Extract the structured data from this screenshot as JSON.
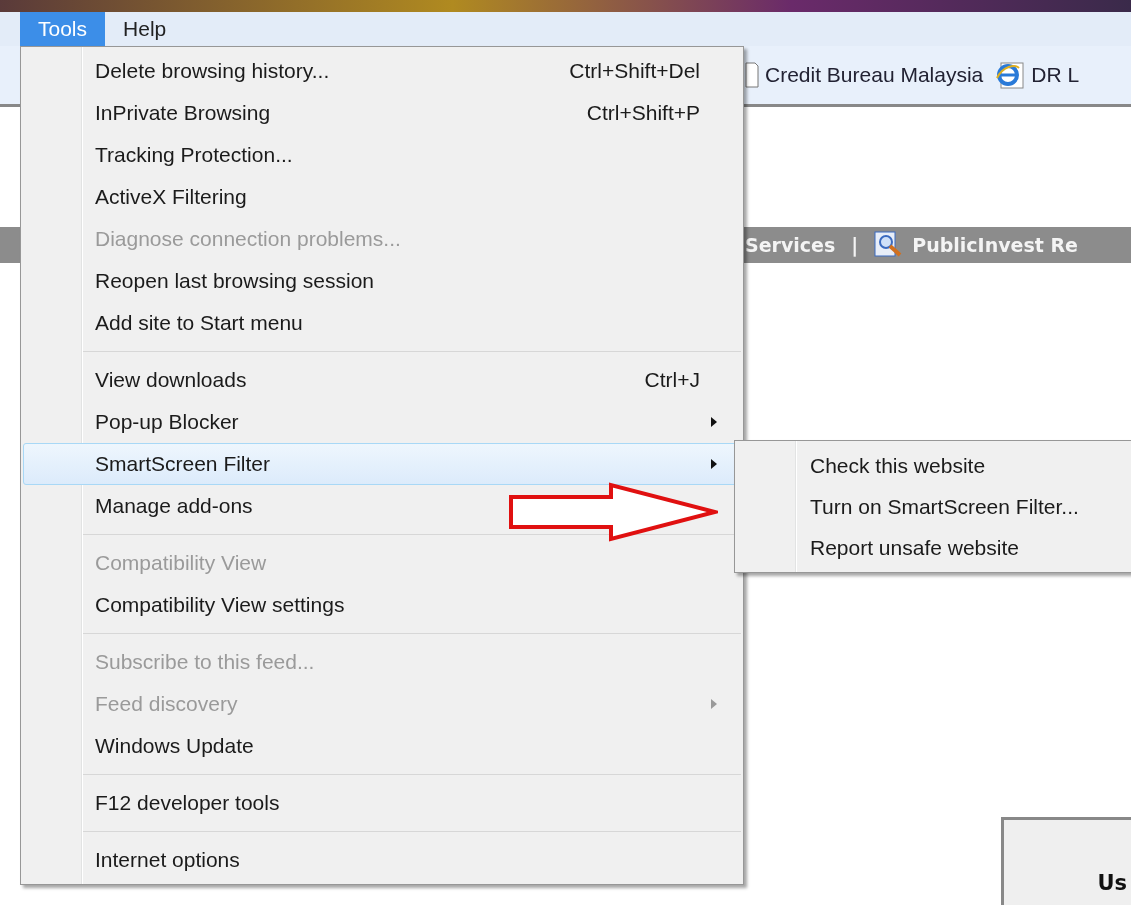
{
  "menu_bar": [
    {
      "label": "Tools",
      "selected": true
    },
    {
      "label": "Help",
      "selected": false
    }
  ],
  "favorites_bar": [
    {
      "label": "Credit Bureau Malaysia"
    },
    {
      "label": "DR L"
    }
  ],
  "nav_strip": [
    {
      "label": "Services"
    },
    {
      "label": "PublicInvest Re"
    }
  ],
  "nav_divider": "|",
  "content_box": {
    "label": "Us"
  },
  "tools_menu": [
    {
      "kind": "item",
      "label": "Delete browsing history...",
      "shortcut": "Ctrl+Shift+Del",
      "disabled": false,
      "submenu": false,
      "selected": false
    },
    {
      "kind": "item",
      "label": "InPrivate Browsing",
      "shortcut": "Ctrl+Shift+P",
      "disabled": false,
      "submenu": false,
      "selected": false
    },
    {
      "kind": "item",
      "label": "Tracking Protection...",
      "disabled": false,
      "submenu": false,
      "selected": false
    },
    {
      "kind": "item",
      "label": "ActiveX Filtering",
      "disabled": false,
      "submenu": false,
      "selected": false
    },
    {
      "kind": "item",
      "label": "Diagnose connection problems...",
      "disabled": true,
      "submenu": false,
      "selected": false
    },
    {
      "kind": "item",
      "label": "Reopen last browsing session",
      "disabled": false,
      "submenu": false,
      "selected": false
    },
    {
      "kind": "item",
      "label": "Add site to Start menu",
      "disabled": false,
      "submenu": false,
      "selected": false
    },
    {
      "kind": "separator"
    },
    {
      "kind": "item",
      "label": "View downloads",
      "shortcut": "Ctrl+J",
      "disabled": false,
      "submenu": false,
      "selected": false
    },
    {
      "kind": "item",
      "label": "Pop-up Blocker",
      "disabled": false,
      "submenu": true,
      "selected": false
    },
    {
      "kind": "item",
      "label": "SmartScreen Filter",
      "disabled": false,
      "submenu": true,
      "selected": true
    },
    {
      "kind": "item",
      "label": "Manage add-ons",
      "disabled": false,
      "submenu": false,
      "selected": false
    },
    {
      "kind": "separator"
    },
    {
      "kind": "item",
      "label": "Compatibility View",
      "disabled": true,
      "submenu": false,
      "selected": false
    },
    {
      "kind": "item",
      "label": "Compatibility View settings",
      "disabled": false,
      "submenu": false,
      "selected": false
    },
    {
      "kind": "separator"
    },
    {
      "kind": "item",
      "label": "Subscribe to this feed...",
      "disabled": true,
      "submenu": false,
      "selected": false
    },
    {
      "kind": "item",
      "label": "Feed discovery",
      "disabled": true,
      "submenu": true,
      "selected": false
    },
    {
      "kind": "item",
      "label": "Windows Update",
      "disabled": false,
      "submenu": false,
      "selected": false
    },
    {
      "kind": "separator"
    },
    {
      "kind": "item",
      "label": "F12 developer tools",
      "disabled": false,
      "submenu": false,
      "selected": false
    },
    {
      "kind": "separator"
    },
    {
      "kind": "item",
      "label": "Internet options",
      "disabled": false,
      "submenu": false,
      "selected": false
    }
  ],
  "smartscreen_submenu": [
    {
      "label": "Check this website"
    },
    {
      "label": "Turn on SmartScreen Filter..."
    },
    {
      "label": "Report unsafe website"
    }
  ]
}
